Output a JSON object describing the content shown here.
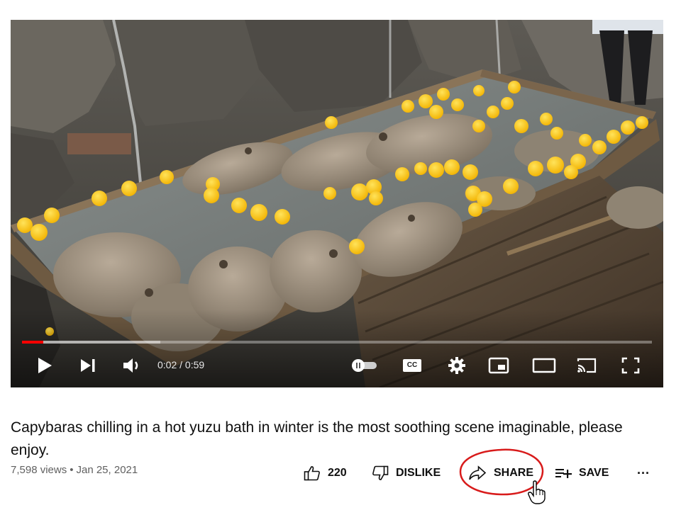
{
  "player": {
    "current_time": "0:02",
    "separator": " / ",
    "duration": "0:59",
    "played_fraction": 0.034,
    "buffered_fraction": 0.22,
    "progress_color": "#ff0000",
    "icons": [
      "play-icon",
      "next-icon",
      "volume-icon",
      "autoplay-toggle-icon",
      "captions-icon",
      "settings-icon",
      "miniplayer-icon",
      "theater-mode-icon",
      "cast-icon",
      "fullscreen-icon"
    ],
    "captions_label": "CC"
  },
  "video": {
    "title": "Capybaras chilling in a hot yuzu bath in winter is the most soothing scene imaginable, please enjoy.",
    "views": "7,598 views",
    "dot": "•",
    "date": "Jan 25, 2021"
  },
  "actions": {
    "like_count": "220",
    "dislike_label": "DISLIKE",
    "share_label": "SHARE",
    "save_label": "SAVE",
    "more_label": "···",
    "highlight_color": "#d81b1b"
  }
}
